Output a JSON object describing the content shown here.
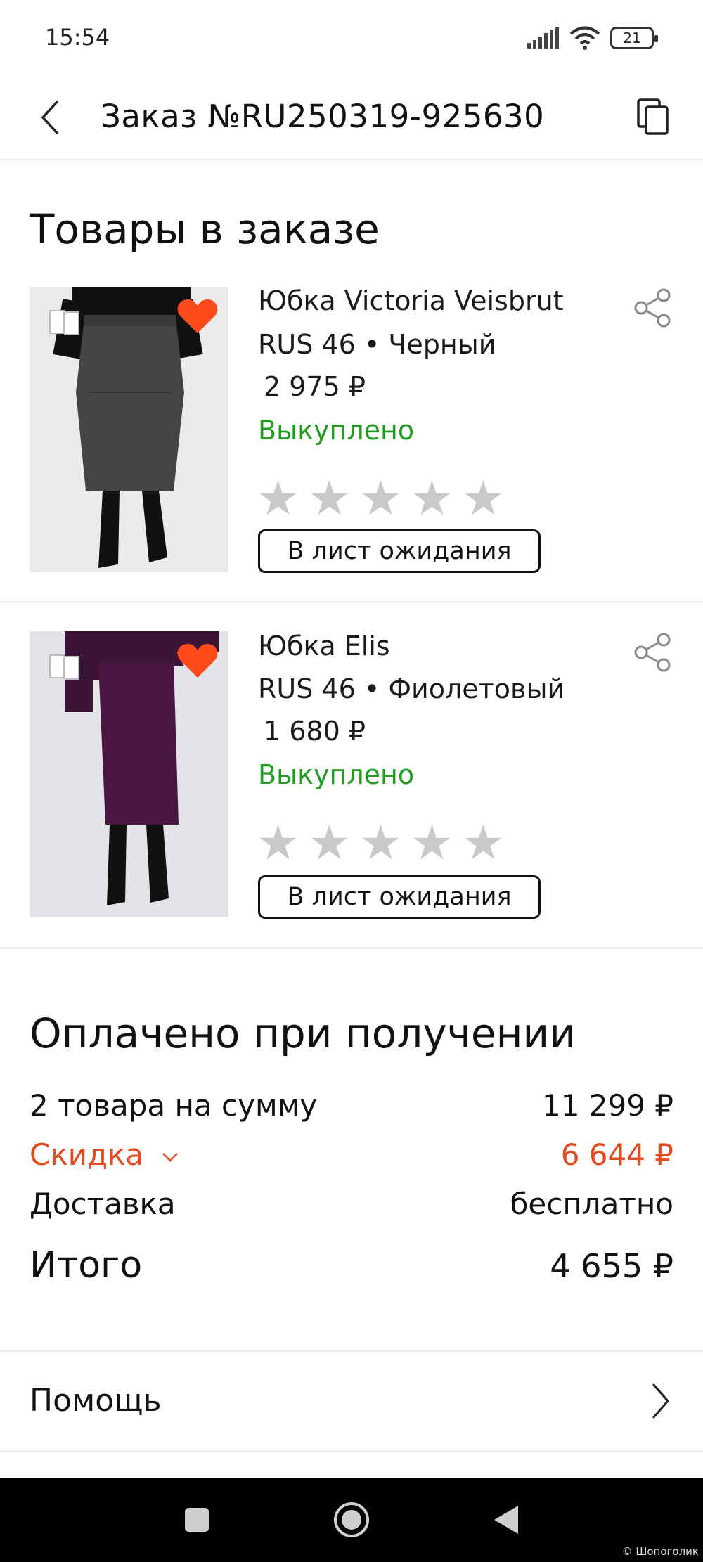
{
  "status_bar": {
    "time": "15:54",
    "battery": "21"
  },
  "header": {
    "title": "Заказ №RU250319-925630"
  },
  "items_section": {
    "title": "Товары в заказе"
  },
  "products": [
    {
      "name": "Юбка Victoria Veisbrut",
      "variant": "RUS 46 • Черный",
      "price": "2 975 ₽",
      "status": "Выкуплено",
      "waitlist_label": "В лист ожидания"
    },
    {
      "name": "Юбка Elis",
      "variant": "RUS 46 • Фиолетовый",
      "price": "1 680 ₽",
      "status": "Выкуплено",
      "waitlist_label": "В лист ожидания"
    }
  ],
  "payment": {
    "title": "Оплачено при получении",
    "subtotal_label": "2 товара на сумму",
    "subtotal_value": "11 299 ₽",
    "discount_label": "Скидка",
    "discount_value": "6 644 ₽",
    "delivery_label": "Доставка",
    "delivery_value": "бесплатно",
    "total_label": "Итого",
    "total_value": "4 655 ₽"
  },
  "help": {
    "label": "Помощь"
  },
  "watermark": "© Шопоголик",
  "colors": {
    "status_green": "#1f9d1f",
    "discount_orange": "#e14b1f",
    "heart": "#ff4a1c",
    "star_gray": "#c9c9c9"
  },
  "icons": [
    "back-chevron-icon",
    "copy-icon",
    "share-icon",
    "heart-icon",
    "compare-icon",
    "star-icon",
    "chevron-right-icon",
    "chevron-down-icon"
  ]
}
